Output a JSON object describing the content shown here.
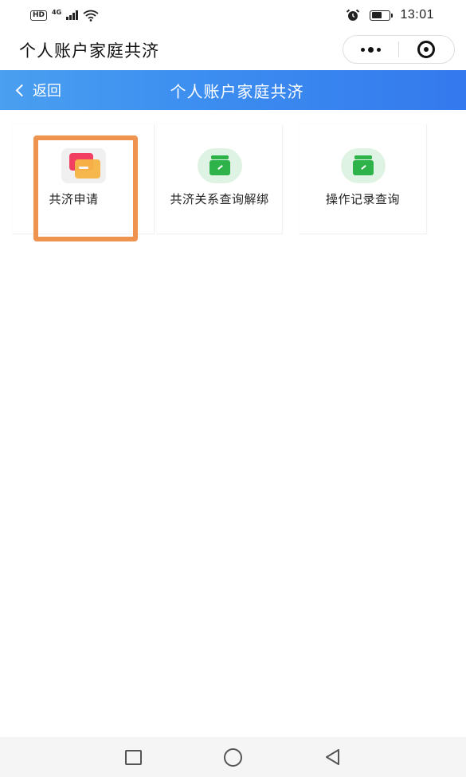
{
  "status_bar": {
    "hd_badge": "HD",
    "network_type": "4G",
    "time": "13:01",
    "icons": [
      "hd-icon",
      "signal-icon",
      "wifi-icon",
      "alarm-icon",
      "battery-icon"
    ]
  },
  "mini_program": {
    "title": "个人账户家庭共济",
    "capsule_icons": [
      "more-icon",
      "close-target-icon"
    ]
  },
  "header": {
    "back_label": "返回",
    "title": "个人账户家庭共济",
    "background": "#3d8ff0"
  },
  "cards": [
    {
      "label": "共济申请",
      "icon": "apply-cards-icon",
      "selected": true
    },
    {
      "label": "共济关系查询解绑",
      "icon": "green-box-icon",
      "selected": false
    },
    {
      "label": "操作记录查询",
      "icon": "green-box-icon",
      "selected": false
    }
  ],
  "highlight_color": "#ee9450",
  "system_nav": {
    "icons": [
      "recent-apps-icon",
      "home-icon",
      "back-triangle-icon"
    ]
  }
}
